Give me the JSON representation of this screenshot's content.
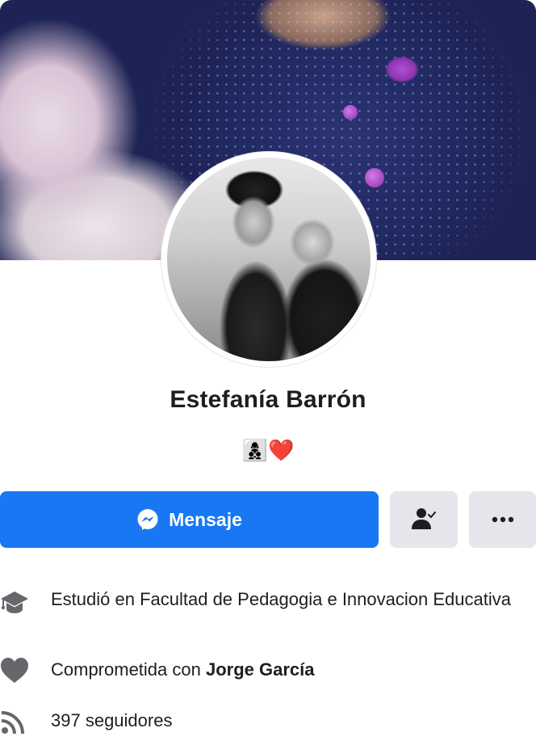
{
  "profile": {
    "name": "Estefanía Barrón",
    "bio_emoji_family": "👩‍👦‍👦",
    "bio_emoji_heart": "❤️"
  },
  "actions": {
    "message_label": "Mensaje",
    "friend_icon": "friend-check-icon",
    "more_icon": "more-dots-icon"
  },
  "intro": {
    "education_prefix": "Estudió en ",
    "education_place": "Facultad de Pedagogia e Innovacion Educativa",
    "relationship_prefix": "Comprometida con ",
    "relationship_partner": "Jorge García",
    "followers_count": "397",
    "followers_suffix": " seguidores"
  },
  "colors": {
    "primary": "#1877f2",
    "button_gray": "#e4e6eb",
    "icon_gray": "#65676b",
    "text": "#1c1e21"
  }
}
